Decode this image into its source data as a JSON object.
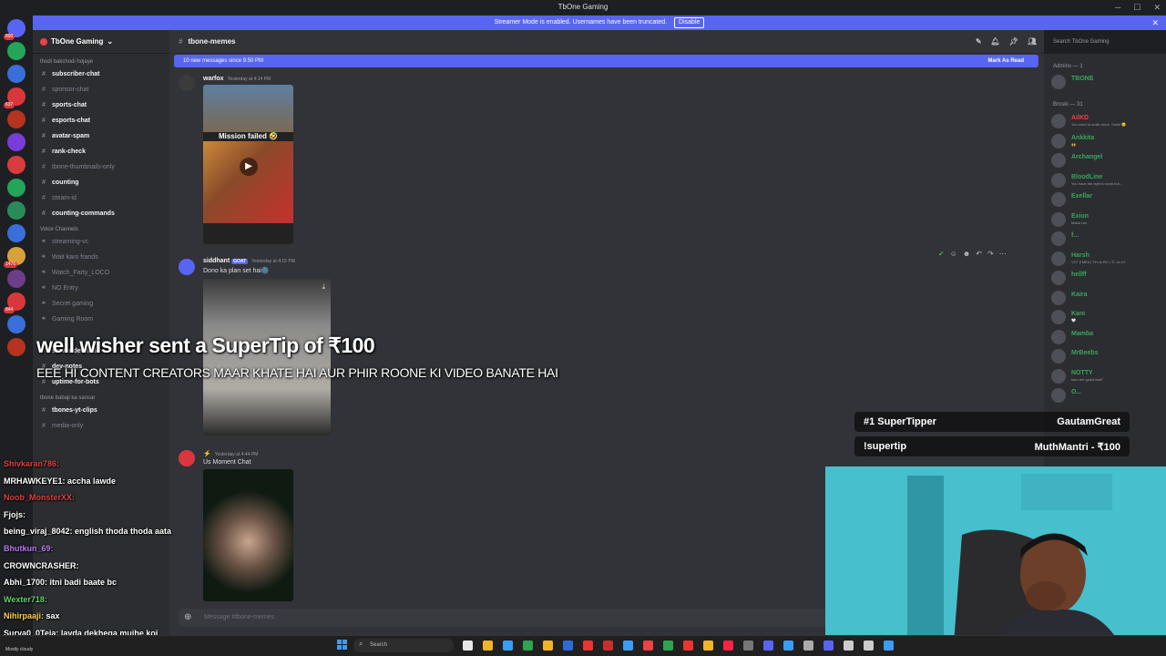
{
  "window": {
    "title": "TbOne Gaming"
  },
  "banner": {
    "text": "Streamer Mode is enabled. Usernames have been truncated.",
    "button": "Disable"
  },
  "server_icons": [
    {
      "badge": "800",
      "color": "#5865f2"
    },
    {
      "badge": "",
      "color": "#23a55a"
    },
    {
      "badge": "",
      "color": "#3a6ed8"
    },
    {
      "badge": "637",
      "color": "#da373c"
    },
    {
      "badge": "",
      "color": "#b5331f"
    },
    {
      "badge": "",
      "color": "#7a3cd8"
    },
    {
      "badge": "",
      "color": "#d83c3c"
    },
    {
      "badge": "",
      "color": "#23a55a"
    },
    {
      "badge": "",
      "color": "#2a8a5a"
    },
    {
      "badge": "",
      "color": "#3a6ed8"
    },
    {
      "badge": "1476",
      "color": "#d8a13c"
    },
    {
      "badge": "",
      "color": "#6d3c8a"
    },
    {
      "badge": "844",
      "color": "#da373c"
    },
    {
      "badge": "",
      "color": "#3a6ed8"
    },
    {
      "badge": "",
      "color": "#b5331f"
    }
  ],
  "guild": {
    "name": "TbOne Gaming"
  },
  "channels": {
    "category1": "thodi bakchodi hojaye",
    "text1": [
      {
        "name": "subscriber-chat",
        "active": true
      },
      {
        "name": "sponsor-chat",
        "active": false
      },
      {
        "name": "sports-chat",
        "active": true
      },
      {
        "name": "esports-chat",
        "active": true
      },
      {
        "name": "avatar-spam",
        "active": true
      },
      {
        "name": "rank-check",
        "active": true
      },
      {
        "name": "tbone-thumbnails-only",
        "active": false
      },
      {
        "name": "counting",
        "active": true
      },
      {
        "name": "steam-id",
        "active": false
      },
      {
        "name": "counting-commands",
        "active": true
      }
    ],
    "category2": "Voice Channels",
    "voice": [
      "streaming-vc",
      "Wait karo frands",
      "Watch_Farty_LOCO",
      "NO Entry",
      "Secret gaming",
      "Gaming Room"
    ],
    "text2": [
      {
        "name": "server-dev-todo",
        "active": true
      },
      {
        "name": "dev-notes",
        "active": true
      },
      {
        "name": "uptime-for-bots",
        "active": true
      }
    ],
    "category3": "tbone babaji ka sansar",
    "text3": [
      {
        "name": "tbones-yt-clips",
        "active": true
      },
      {
        "name": "media-only",
        "active": false
      }
    ]
  },
  "channel_header": {
    "name": "tbone-memes",
    "search_placeholder": "Search TbOne Gaming"
  },
  "new_messages": {
    "text": "10 new messages since 9:50 PM",
    "action": "Mark As Read"
  },
  "messages": [
    {
      "user": "warfox",
      "time": "Yesterday at 4:14 PM",
      "text": "",
      "media_caption": "Mission failed 🤣"
    },
    {
      "user": "siddhant",
      "tag": "GOAT",
      "time": "Yesterday at 4:15 PM",
      "text": "Dono ka plan set hai🌚"
    },
    {
      "user": "⚡",
      "time": "Yesterday at 4:44 PM",
      "text": "Us Moment Chat"
    }
  ],
  "message_input": {
    "placeholder": "Message #tbone-memes"
  },
  "members": {
    "admins_header": "Admins — 1",
    "admins": [
      {
        "name": "TBONE",
        "color": "#3ba55c",
        "status": ""
      }
    ],
    "broski_header": "Broski — 31",
    "list": [
      {
        "name": "AilKD",
        "color": "#f23f43",
        "status": "You need to smile more. Smile 😊"
      },
      {
        "name": "Ankkita",
        "color": "#3ba55c",
        "status": "🙌"
      },
      {
        "name": "Archangel",
        "color": "#3ba55c",
        "status": ""
      },
      {
        "name": "BloodLine",
        "color": "#3ba55c",
        "status": "You have the right to work but..."
      },
      {
        "name": "Exellar",
        "color": "#3ba55c",
        "status": ""
      },
      {
        "name": "Exion",
        "color": "#3ba55c",
        "status": "Malai Lav"
      },
      {
        "name": "f...",
        "color": "#3ba55c",
        "status": ""
      },
      {
        "name": "Harsh",
        "color": "#3ba55c",
        "status": "VCT EMEA | TH vs RC | TL vs LV"
      },
      {
        "name": "hellff",
        "color": "#3ba55c",
        "status": ""
      },
      {
        "name": "Kaira",
        "color": "#3ba55c",
        "status": ""
      },
      {
        "name": "Kani",
        "color": "#3ba55c",
        "status": "🤍"
      },
      {
        "name": "Mamba",
        "color": "#3ba55c",
        "status": ""
      },
      {
        "name": "MrBeebs",
        "color": "#3ba55c",
        "status": ""
      },
      {
        "name": "NOTTY",
        "color": "#3ba55c",
        "status": "karu teri guddi laal?"
      },
      {
        "name": "O...",
        "color": "#3ba55c",
        "status": ""
      }
    ]
  },
  "overlay": {
    "tip_title": "well wisher sent a SuperTip of ₹100",
    "tip_message": "EEE HI CONTENT CREATORS MAAR KHATE HAI AUR PHIR ROONE KI VIDEO BANATE HAI",
    "leaderboard": [
      {
        "left": "#1 SuperTipper",
        "right": "GautamGreat"
      },
      {
        "left": "!supertip",
        "right": "MuthMantri - ₹100"
      }
    ]
  },
  "live_chat": [
    {
      "user": "Shivkaran786:",
      "text": "",
      "color": "#e04141"
    },
    {
      "user": "MRHAWKEYE1:",
      "text": "accha lawde",
      "color": "#ffffff"
    },
    {
      "user": "Noob_MonsterXX:",
      "text": "",
      "color": "#e04141"
    },
    {
      "user": "Fjojs:",
      "text": "",
      "color": "#ffffff"
    },
    {
      "user": "being_viraj_8042:",
      "text": "english thoda thoda aata",
      "color": "#ffffff"
    },
    {
      "user": "Bhutkun_69:",
      "text": "",
      "color": "#b97cf5"
    },
    {
      "user": "CROWNCRASHER:",
      "text": "",
      "color": "#ffffff"
    },
    {
      "user": "Abhi_1700:",
      "text": "itni badi baate bc",
      "color": "#ffffff"
    },
    {
      "user": "Wexter718:",
      "text": "",
      "color": "#62d26f"
    },
    {
      "user": "Nihirpaaji:",
      "text": "sax",
      "color": "#ffd24d"
    },
    {
      "user": "Surya0_0Teja:",
      "text": "lavda dekhega mujhe koi",
      "color": "#ffffff"
    }
  ],
  "taskbar": {
    "search": "Search",
    "weather": "Mostly cloudy"
  }
}
